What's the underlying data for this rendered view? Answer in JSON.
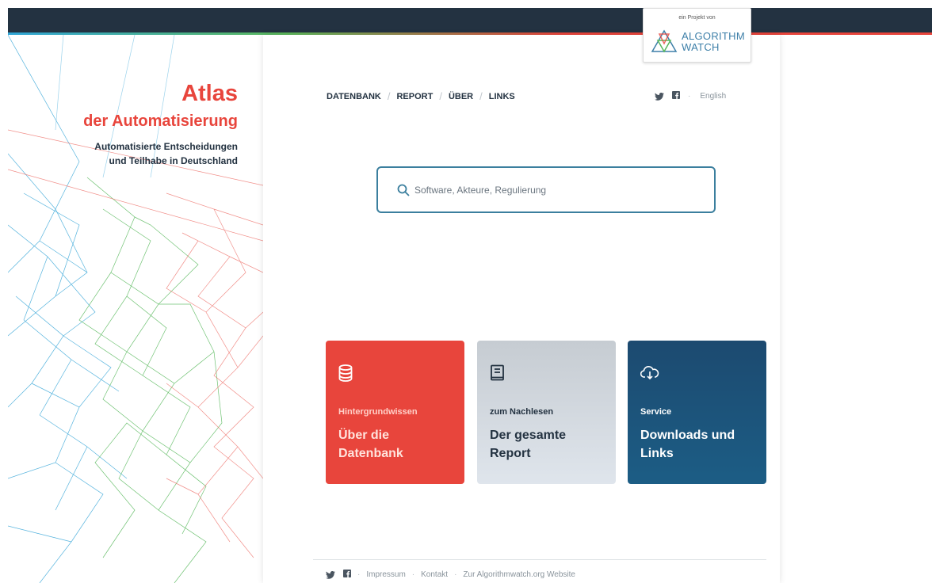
{
  "brand": {
    "title": "Atlas",
    "subtitle": "der Automatisierung",
    "tagline_line1": "Automatisierte Entscheidungen",
    "tagline_line2": "und Teilhabe in Deutschland"
  },
  "badge": {
    "small_text": "ein Projekt von",
    "name_line1": "ALGORITHM",
    "name_line2": "WATCH"
  },
  "nav": {
    "items": [
      {
        "label": "DATENBANK"
      },
      {
        "label": "REPORT"
      },
      {
        "label": "ÜBER"
      },
      {
        "label": "LINKS"
      }
    ],
    "separator": "/"
  },
  "social": {
    "twitter_icon": "twitter-icon",
    "facebook_icon": "facebook-icon",
    "language": "English"
  },
  "search": {
    "placeholder": "Software, Akteure, Regulierung",
    "value": ""
  },
  "cards": [
    {
      "icon": "database-icon",
      "kicker": "Hintergrundwissen",
      "title": "Über die Datenbank",
      "color": "#e8453c"
    },
    {
      "icon": "book-icon",
      "kicker": "zum Nachlesen",
      "title": "Der gesamte Report",
      "color": "#d3d9df"
    },
    {
      "icon": "cloud-download-icon",
      "kicker": "Service",
      "title": "Downloads und Links",
      "color": "#1c4f75"
    }
  ],
  "footer": {
    "links": [
      {
        "label": "Impressum"
      },
      {
        "label": "Kontakt"
      },
      {
        "label": "Zur Algorithmwatch.org Website"
      }
    ]
  },
  "colors": {
    "accent_red": "#e8453c",
    "dark_navy": "#233241",
    "search_border": "#3b7f9e"
  }
}
